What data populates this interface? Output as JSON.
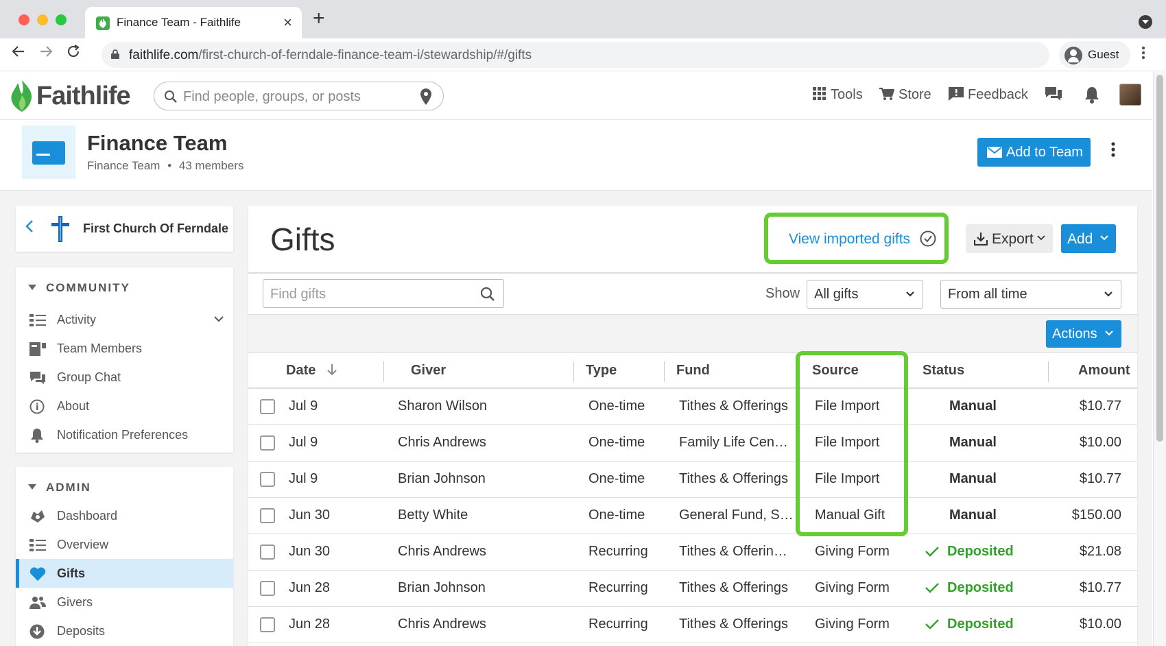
{
  "browser": {
    "tab_title": "Finance Team - Faithlife",
    "tab_close": "×",
    "new_tab": "+",
    "url_domain": "faithlife.com",
    "url_path": "/first-church-of-ferndale-finance-team-i/stewardship/#/gifts",
    "profile_label": "Guest"
  },
  "site_header": {
    "logo_text": "Faithlife",
    "search_placeholder": "Find people, groups, or posts",
    "links": {
      "tools": "Tools",
      "store": "Store",
      "feedback": "Feedback"
    }
  },
  "group": {
    "name": "Finance Team",
    "subtitle": "Finance Team",
    "separator": "•",
    "members": "43 members",
    "add_button": "Add to Team"
  },
  "sidebar": {
    "church_name": "First Church Of Ferndale",
    "community": {
      "title": "COMMUNITY",
      "items": [
        {
          "label": "Activity",
          "icon": "list-icon"
        },
        {
          "label": "Team Members",
          "icon": "members-icon"
        },
        {
          "label": "Group Chat",
          "icon": "chat-icon"
        },
        {
          "label": "About",
          "icon": "info-icon"
        },
        {
          "label": "Notification Preferences",
          "icon": "bell-icon"
        }
      ]
    },
    "admin": {
      "title": "ADMIN",
      "items": [
        {
          "label": "Dashboard",
          "icon": "dashboard-icon"
        },
        {
          "label": "Overview",
          "icon": "list-icon"
        },
        {
          "label": "Gifts",
          "icon": "heart-icon",
          "active": true
        },
        {
          "label": "Givers",
          "icon": "people-icon"
        },
        {
          "label": "Deposits",
          "icon": "download-icon"
        }
      ]
    }
  },
  "gifts": {
    "title": "Gifts",
    "view_imported": "View imported gifts",
    "export_label": "Export",
    "add_label": "Add",
    "find_placeholder": "Find gifts",
    "show_label": "Show",
    "filter_type": "All gifts",
    "filter_time": "From all time",
    "actions_label": "Actions",
    "columns": {
      "date": "Date",
      "giver": "Giver",
      "type": "Type",
      "fund": "Fund",
      "source": "Source",
      "status": "Status",
      "amount": "Amount"
    },
    "rows": [
      {
        "date": "Jul 9",
        "giver": "Sharon Wilson",
        "type": "One-time",
        "fund": "Tithes & Offerings",
        "source": "File Import",
        "status": "Manual",
        "amount": "$10.77"
      },
      {
        "date": "Jul 9",
        "giver": "Chris Andrews",
        "type": "One-time",
        "fund": "Family Life Cen…",
        "source": "File Import",
        "status": "Manual",
        "amount": "$10.00"
      },
      {
        "date": "Jul 9",
        "giver": "Brian Johnson",
        "type": "One-time",
        "fund": "Tithes & Offerings",
        "source": "File Import",
        "status": "Manual",
        "amount": "$10.77"
      },
      {
        "date": "Jun 30",
        "giver": "Betty White",
        "type": "One-time",
        "fund": "General Fund, S…",
        "source": "Manual Gift",
        "status": "Manual",
        "amount": "$150.00"
      },
      {
        "date": "Jun 30",
        "giver": "Chris Andrews",
        "type": "Recurring",
        "fund": "Tithes & Offerin…",
        "source": "Giving Form",
        "status": "Deposited",
        "amount": "$21.08"
      },
      {
        "date": "Jun 28",
        "giver": "Brian Johnson",
        "type": "Recurring",
        "fund": "Tithes & Offerings",
        "source": "Giving Form",
        "status": "Deposited",
        "amount": "$10.77"
      },
      {
        "date": "Jun 28",
        "giver": "Chris Andrews",
        "type": "Recurring",
        "fund": "Tithes & Offerings",
        "source": "Giving Form",
        "status": "Deposited",
        "amount": "$10.00"
      }
    ]
  },
  "colors": {
    "brand_blue": "#1a8fd9",
    "highlight_green": "#66cc33",
    "deposited_green": "#33a02c",
    "active_nav_bg": "#d6ecfb"
  }
}
